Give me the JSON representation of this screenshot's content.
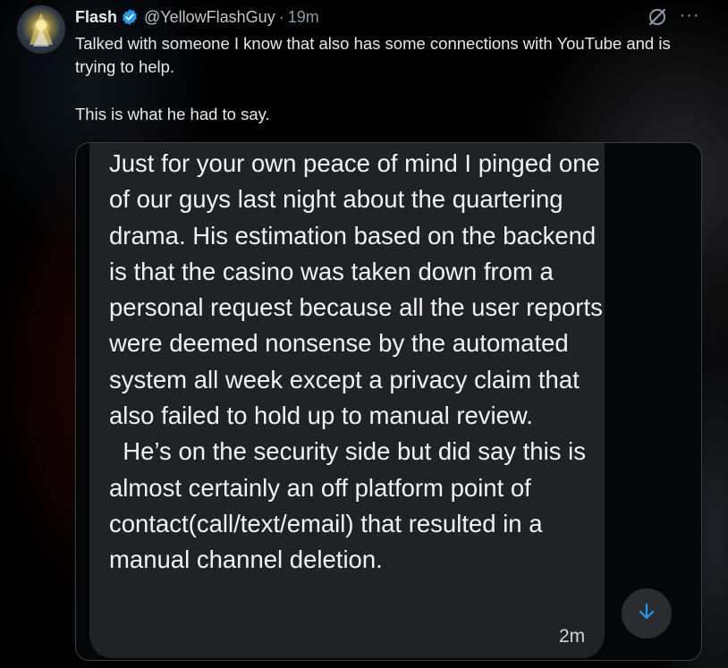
{
  "tweet": {
    "author_name": "Flash",
    "handle": "@YellowFlashGuy",
    "separator": "·",
    "time": "19m",
    "text_line1": "Talked with someone I know that also has some connections with YouTube and is trying to help.",
    "text_line2": "This is what he had to say."
  },
  "media": {
    "message_paragraph1": "Just for your own peace of mind I pinged one of our guys last night about the quartering drama. His estimation based on the backend is that the casino was taken down from a personal request because all the user reports were deemed nonsense by the automated system all week except a privacy claim that also failed to hold up to manual review.",
    "message_paragraph2": "  He’s on the security side but did say this is almost certainly an off platform point of contact(call/text/email) that resulted in a manual channel deletion.",
    "timestamp": "2m"
  },
  "icons": {
    "verified": "verified-badge-icon",
    "grok": "grok-icon",
    "more": "more-icon",
    "scroll": "arrow-down-icon"
  },
  "colors": {
    "background": "#000000",
    "verified_blue": "#1d9bf0",
    "bubble": "#202225",
    "scroll_arrow": "#1d9bf0"
  }
}
